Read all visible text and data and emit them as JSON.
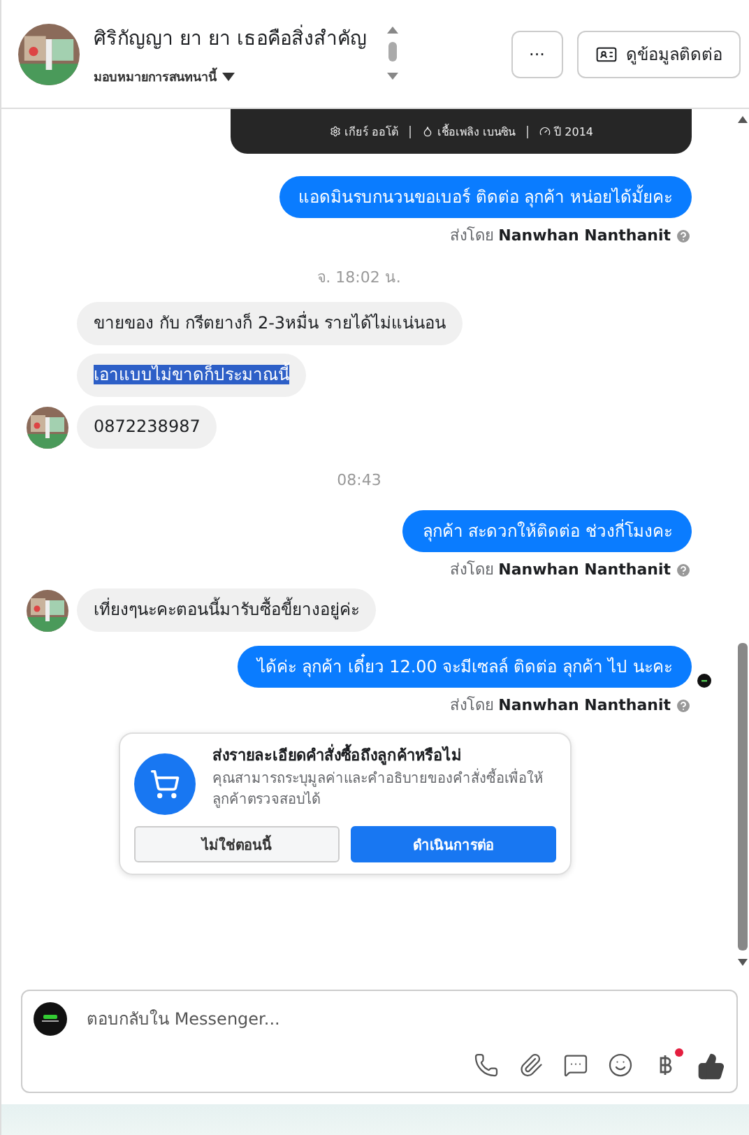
{
  "header": {
    "name": "ศิริกัญญา ยา ยา เธอคือสิ่งสำคัญ",
    "assign_label": "มอบหมายการสนทนานี้",
    "more_button": "···",
    "contact_button": "ดูข้อมูลติดต่อ"
  },
  "card_meta": [
    "เกียร์ ออโต้",
    "เชื้อเพลิง เบนซิน",
    "ปี 2014"
  ],
  "messages": [
    {
      "kind": "outgoing",
      "text": "แอดมินรบกนวนขอเบอร์ ติดต่อ ลุกค้า หน่อยได้มั้ยคะ",
      "seen": false
    },
    {
      "kind": "sent_by",
      "prefix": "ส่งโดย",
      "name": "Nanwhan Nanthanit"
    },
    {
      "kind": "time",
      "text": "จ. 18:02 น."
    },
    {
      "kind": "incoming",
      "text": "ขายของ กับ กรีตยางก็ 2-3หมื่น รายได้ไม่แน่นอน",
      "avatar": false,
      "highlighted": false
    },
    {
      "kind": "incoming",
      "text": "เอาแบบไม่ขาดก็ประมาณนี้",
      "avatar": false,
      "highlighted": true
    },
    {
      "kind": "incoming",
      "text": "0872238987",
      "avatar": true,
      "highlighted": false
    },
    {
      "kind": "time",
      "text": "08:43"
    },
    {
      "kind": "outgoing",
      "text": "ลุกค้า สะดวกให้ติดต่อ ช่วงกี่โมงคะ",
      "seen": false
    },
    {
      "kind": "sent_by",
      "prefix": "ส่งโดย",
      "name": "Nanwhan Nanthanit"
    },
    {
      "kind": "incoming",
      "text": "เที่ยงๆนะคะตอนนี้มารับซื้อขี้ยางอยู่ค่ะ",
      "avatar": true,
      "highlighted": false
    },
    {
      "kind": "outgoing",
      "text": "ได้ค่ะ  ลุกค้า เดี๋ยว 12.00 จะมีเซลล์ ติดต่อ ลุกค้า ไป นะคะ",
      "seen": true
    },
    {
      "kind": "sent_by",
      "prefix": "ส่งโดย",
      "name": "Nanwhan Nanthanit"
    }
  ],
  "order_prompt": {
    "title": "ส่งรายละเอียดคำสั่งซื้อถึงลูกค้าหรือไม่",
    "body": "คุณสามารถระบุมูลค่าและคำอธิบายของคำสั่งซื้อเพื่อให้ลูกค้าตรวจสอบได้",
    "buttons": [
      {
        "label": "ไม่ใช่ตอนนี้",
        "primary": false
      },
      {
        "label": "ดำเนินการต่อ",
        "primary": true
      }
    ]
  },
  "composer": {
    "placeholder": "ตอบกลับใน Messenger...",
    "tools": [
      {
        "kind": "call",
        "badge": false
      },
      {
        "kind": "attach",
        "badge": false
      },
      {
        "kind": "chat",
        "badge": false
      },
      {
        "kind": "emoji",
        "badge": false
      },
      {
        "kind": "baht",
        "badge": true
      },
      {
        "kind": "like",
        "badge": false
      }
    ]
  }
}
